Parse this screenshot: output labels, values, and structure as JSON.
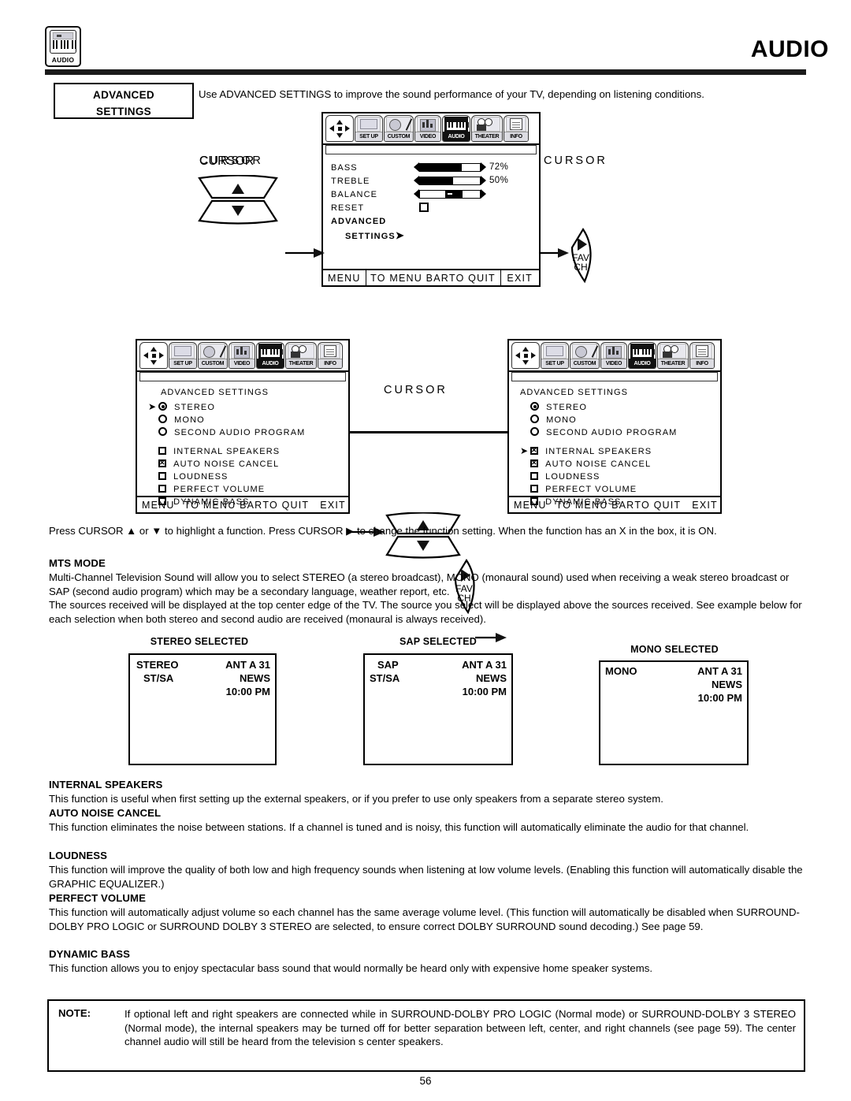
{
  "header": {
    "badge_label": "AUDIO",
    "badge_icon": "audio-keyboard-icon",
    "page_title": "AUDIO"
  },
  "section": {
    "label_line1": "ADVANCED",
    "label_line2": "SETTINGS",
    "intro": "Use ADVANCED SETTINGS to improve the sound performance of your TV, depending on listening conditions."
  },
  "menu_bar": {
    "items": [
      {
        "caption": "",
        "icon": "nav-pad-icon",
        "selected": false
      },
      {
        "caption": "SET UP",
        "icon": "setup-icon",
        "selected": false
      },
      {
        "caption": "CUSTOM",
        "icon": "custom-palette-icon",
        "selected": false
      },
      {
        "caption": "VIDEO",
        "icon": "video-bars-icon",
        "selected": false
      },
      {
        "caption": "AUDIO",
        "icon": "audio-keyboard-icon",
        "selected": true
      },
      {
        "caption": "THEATER",
        "icon": "theater-camera-icon",
        "selected": false
      },
      {
        "caption": "INFO",
        "icon": "info-document-icon",
        "selected": false
      }
    ]
  },
  "bottom_bar": {
    "menu": "MENU",
    "to_menu_bar": "TO MENU BAR",
    "to_quit": "TO QUIT",
    "exit": "EXIT"
  },
  "osd_audio": {
    "rows": [
      {
        "label": "BASS",
        "value": "72%",
        "fill_pct": 72
      },
      {
        "label": "TREBLE",
        "value": "50%",
        "fill_pct": 50
      },
      {
        "label": "BALANCE",
        "value": "",
        "fill_pct": 50
      }
    ],
    "reset_label": "RESET",
    "advanced_label": "ADVANCED",
    "settings_label": "SETTINGS"
  },
  "osd_advanced_left": {
    "title": "ADVANCED SETTINGS",
    "mts_options": [
      {
        "label": "STEREO",
        "selected": true,
        "highlighted": true
      },
      {
        "label": "MONO",
        "selected": false,
        "highlighted": false
      },
      {
        "label": "SECOND AUDIO PROGRAM",
        "selected": false,
        "highlighted": false
      }
    ],
    "toggles": [
      {
        "label": "INTERNAL SPEAKERS",
        "checked": false,
        "highlighted": false
      },
      {
        "label": "AUTO NOISE CANCEL",
        "checked": true,
        "highlighted": false
      },
      {
        "label": "LOUDNESS",
        "checked": false,
        "highlighted": false
      },
      {
        "label": "PERFECT VOLUME",
        "checked": false,
        "highlighted": false
      },
      {
        "label": "DYNAMIC BASS",
        "checked": false,
        "highlighted": false
      }
    ]
  },
  "osd_advanced_right": {
    "title": "ADVANCED SETTINGS",
    "mts_options": [
      {
        "label": "STEREO",
        "selected": true,
        "highlighted": false
      },
      {
        "label": "MONO",
        "selected": false,
        "highlighted": false
      },
      {
        "label": "SECOND AUDIO PROGRAM",
        "selected": false,
        "highlighted": false
      }
    ],
    "toggles": [
      {
        "label": "INTERNAL SPEAKERS",
        "checked": true,
        "highlighted": true
      },
      {
        "label": "AUTO NOISE CANCEL",
        "checked": true,
        "highlighted": false
      },
      {
        "label": "LOUDNESS",
        "checked": false,
        "highlighted": false
      },
      {
        "label": "PERFECT VOLUME",
        "checked": false,
        "highlighted": false
      },
      {
        "label": "DYNAMIC BASS",
        "checked": false,
        "highlighted": false
      }
    ]
  },
  "cursor_diagrams": {
    "label": "CURSOR",
    "fav_line1": "FAV",
    "fav_line2": "CH"
  },
  "instructions": {
    "press_cursor": "Press CURSOR ▲ or ▼ to highlight a function. Press CURSOR ▶ to change the function setting. When the function has an  X  in the box, it is ON."
  },
  "sections": [
    {
      "heading": "MTS MODE",
      "paragraphs": [
        "Multi-Channel Television Sound will allow you to select STEREO (a stereo broadcast), MONO (monaural sound) used when receiving a weak stereo broadcast or SAP (second audio program) which may be a secondary language, weather report, etc.",
        "The sources received will be displayed at the top center edge of the TV.  The source you select will be displayed above the sources received.  See example below for each selection when both stereo and second audio are received (monaural is always received)."
      ]
    },
    {
      "heading": "INTERNAL SPEAKERS",
      "paragraphs": [
        "This function is useful when first setting up the external speakers, or if you prefer to use only speakers from a separate stereo system."
      ]
    },
    {
      "heading": "AUTO NOISE CANCEL",
      "paragraphs": [
        "This function eliminates the noise between stations. If a channel is tuned and is noisy, this function will automatically eliminate the audio for that channel."
      ]
    },
    {
      "heading": "LOUDNESS",
      "paragraphs": [
        "This function will improve the quality of both low and high frequency sounds when listening at low volume levels. (Enabling this function will automatically disable the GRAPHIC EQUALIZER.)"
      ]
    },
    {
      "heading": "PERFECT VOLUME",
      "paragraphs": [
        "This function will automatically adjust volume so each channel has the same average volume level. (This function will automatically be disabled when SURROUND-DOLBY PRO LOGIC or SURROUND DOLBY 3 STEREO are selected, to ensure correct DOLBY SURROUND sound decoding.) See page 59."
      ]
    },
    {
      "heading": "DYNAMIC BASS",
      "paragraphs": [
        "This function allows you to enjoy spectacular bass sound that would normally be heard only with expensive home speaker systems."
      ]
    }
  ],
  "mts_examples": [
    {
      "caption": "STEREO SELECTED",
      "left_line1": "STEREO",
      "left_line2": "ST/SA",
      "right_line1": "ANT A 31",
      "right_line2": "NEWS",
      "right_line3": "10:00 PM"
    },
    {
      "caption": "SAP SELECTED",
      "left_line1": "SAP",
      "left_line2": "ST/SA",
      "right_line1": "ANT A 31",
      "right_line2": "NEWS",
      "right_line3": "10:00 PM"
    },
    {
      "caption": "MONO SELECTED",
      "left_line1": "MONO",
      "left_line2": "",
      "right_line1": "ANT A 31",
      "right_line2": "NEWS",
      "right_line3": "10:00 PM"
    }
  ],
  "note": {
    "label": "NOTE:",
    "text": "If optional left and right speakers are connected while in SURROUND-DOLBY PRO LOGIC (Normal mode) or SURROUND-DOLBY 3 STEREO (Normal mode), the internal speakers may be turned off for better separation between left, center, and right channels (see page 59). The center channel audio will still be heard from the television s center speakers."
  },
  "page_number": "56",
  "colors": {
    "ink": "#000000",
    "rule": "#1b1b1b",
    "panel_fill": "#ffffff",
    "selected_tab": "#111111"
  }
}
